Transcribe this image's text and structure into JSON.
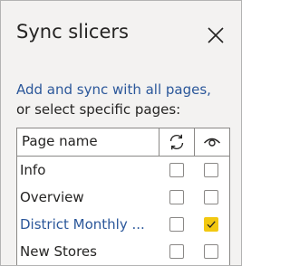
{
  "pane": {
    "title": "Sync slicers",
    "close_icon": "close-icon"
  },
  "instructions": {
    "link_text": "Add and sync with all pages,",
    "text": "or select specific pages:"
  },
  "table": {
    "column_page_name": "Page name",
    "column_sync_icon": "sync-icon",
    "column_visible_icon": "eye-icon",
    "rows": [
      {
        "name": "Info",
        "sync": false,
        "visible": false,
        "selected": false
      },
      {
        "name": "Overview",
        "sync": false,
        "visible": false,
        "selected": false
      },
      {
        "name": "District Monthly ...",
        "sync": false,
        "visible": true,
        "selected": true
      },
      {
        "name": "New Stores",
        "sync": false,
        "visible": false,
        "selected": false
      }
    ]
  },
  "colors": {
    "accent_link": "#2b579a",
    "checked_fill": "#f2c811",
    "pane_background": "#f3f2f1"
  }
}
